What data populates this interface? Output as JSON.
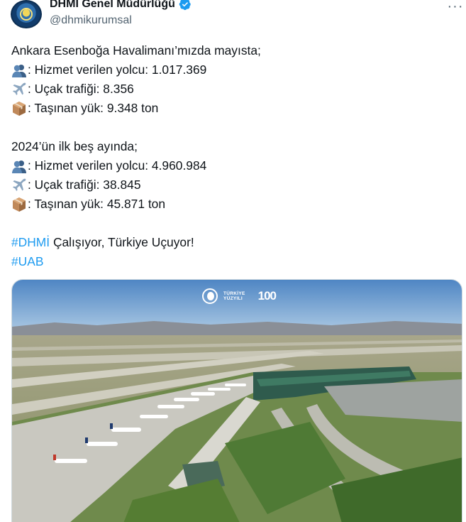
{
  "account": {
    "display_name": "DHMİ Genel Müdürlüğü",
    "handle": "@dhmikurumsal",
    "avatar_icon": "dhmi-logo-icon",
    "verified_icon": "verified-badge-icon"
  },
  "more_icon": "more-options-icon",
  "tweet": {
    "intro": "Ankara Esenboğa Havalimanı’mızda mayısta;",
    "may": {
      "passengers": ": Hizmet verilen yolcu: 1.017.369",
      "aircraft": ": Uçak trafiği: 8.356",
      "cargo": ": Taşınan yük: 9.348 ton"
    },
    "ytd_intro": "2024’ün ilk beş ayında;",
    "ytd": {
      "passengers": ": Hizmet verilen yolcu: 4.960.984",
      "aircraft": ": Uçak trafiği: 38.845",
      "cargo": ": Taşınan yük: 45.871 ton"
    },
    "hashtag_dhmi": "#DHMİ",
    "slogan": " Çalışıyor, Türkiye Uçuyor!",
    "hashtag_uab": "#UAB"
  },
  "media": {
    "logo_line1": "TÜRKİYE",
    "logo_line2": "YÜZYILI",
    "logo_100": "100"
  },
  "colors": {
    "accent": "#1d9bf0",
    "text": "#0f1419",
    "muted": "#536471"
  }
}
